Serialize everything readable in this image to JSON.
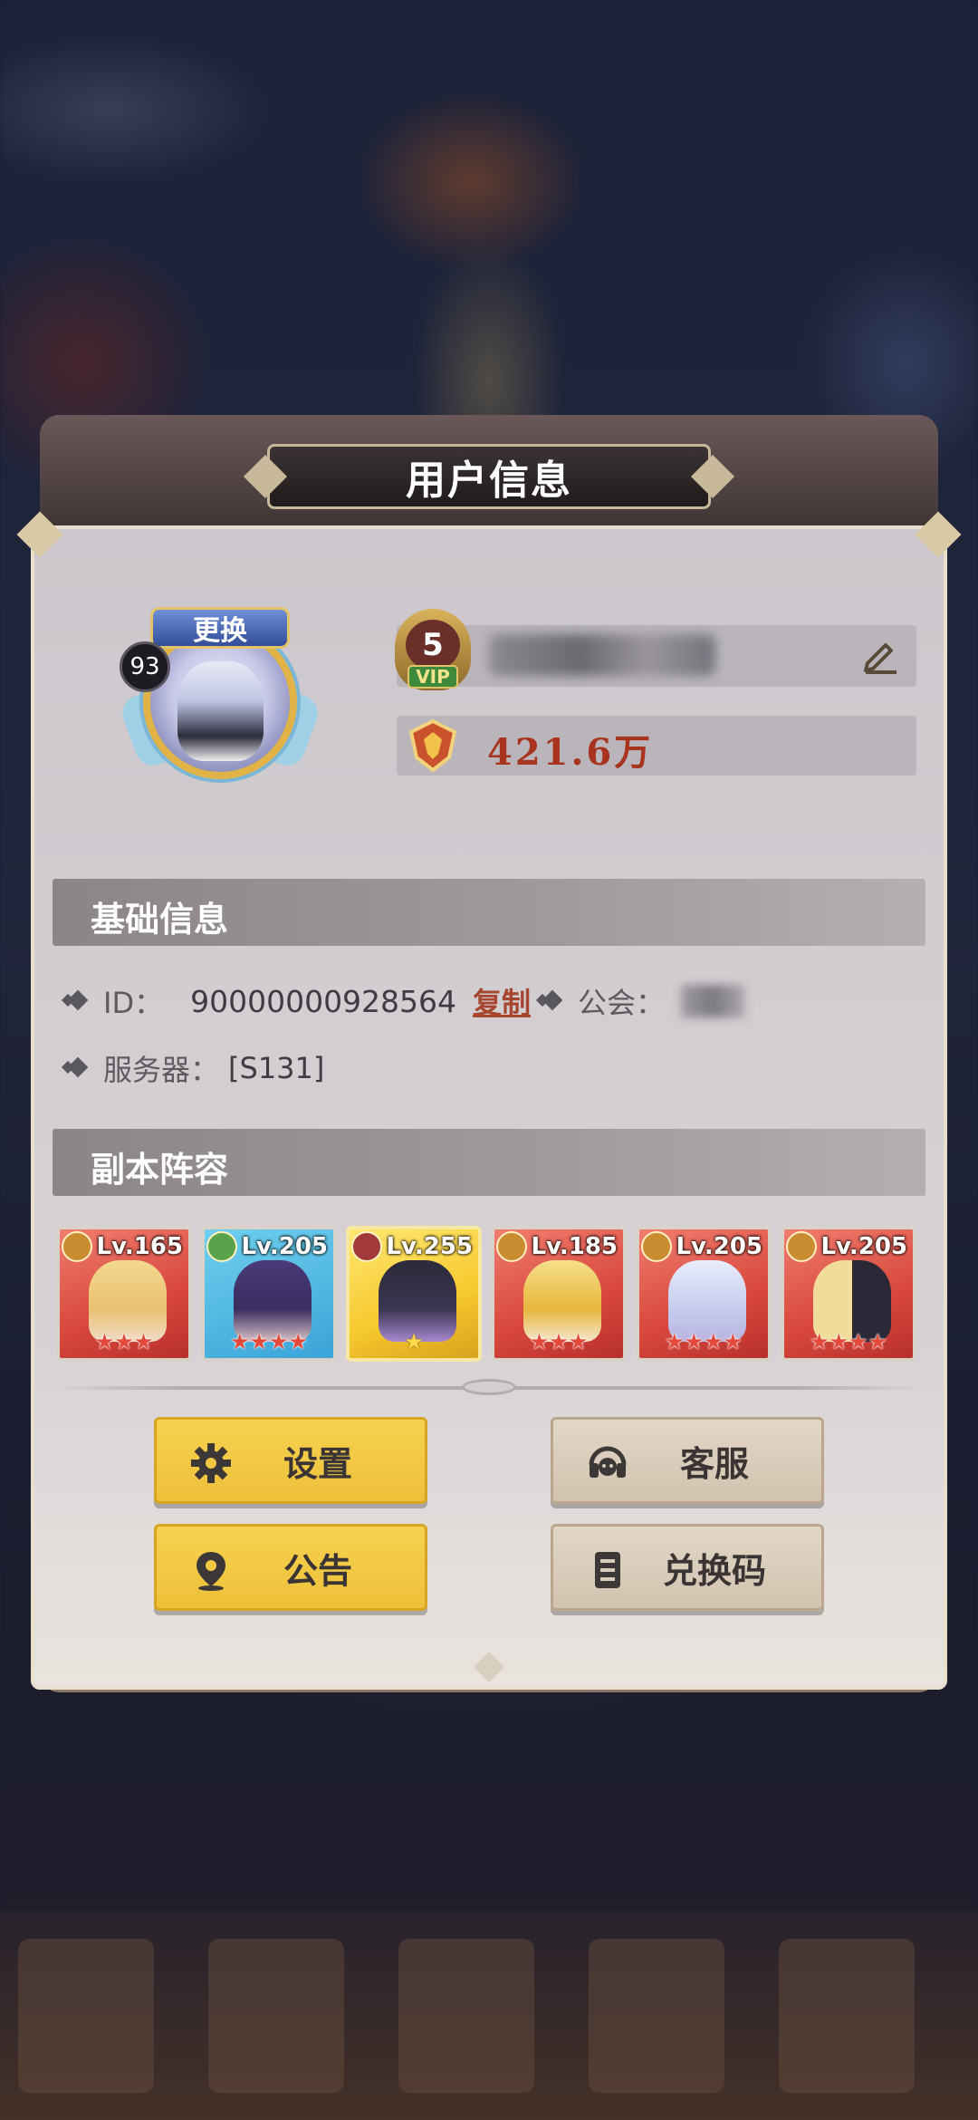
{
  "dialog": {
    "title": "用户信息",
    "change_label": "更换",
    "avatar_level": "93",
    "vip_level": "5",
    "vip_tag": "VIP",
    "power_value": "421.6万"
  },
  "basic_info": {
    "section_title": "基础信息",
    "id_label": "ID：",
    "id_value": "90000000928564",
    "copy_label": "复制",
    "guild_label": "公会：",
    "server_label": "服务器：",
    "server_value": "[S131]"
  },
  "lineup": {
    "section_title": "副本阵容",
    "heroes": [
      {
        "level": "Lv.165",
        "stars": "★★★",
        "faction": "gold"
      },
      {
        "level": "Lv.205",
        "stars": "★★★★",
        "faction": "green"
      },
      {
        "level": "Lv.255",
        "stars": "★",
        "faction": "dark"
      },
      {
        "level": "Lv.185",
        "stars": "★★★",
        "faction": "gold"
      },
      {
        "level": "Lv.205",
        "stars": "★★★★",
        "faction": "gold"
      },
      {
        "level": "Lv.205",
        "stars": "★★★★",
        "faction": "gold"
      }
    ]
  },
  "buttons": {
    "settings": "设置",
    "support": "客服",
    "notice": "公告",
    "redeem": "兑换码"
  },
  "colors": {
    "accent_yellow": "#f2c842",
    "button_tan": "#d9ccba",
    "power_red": "#a8341f",
    "copy_link": "#a6462e"
  },
  "icons": [
    "edit-icon",
    "power-icon",
    "gear-icon",
    "headset-icon",
    "location-pin-icon",
    "document-icon"
  ]
}
